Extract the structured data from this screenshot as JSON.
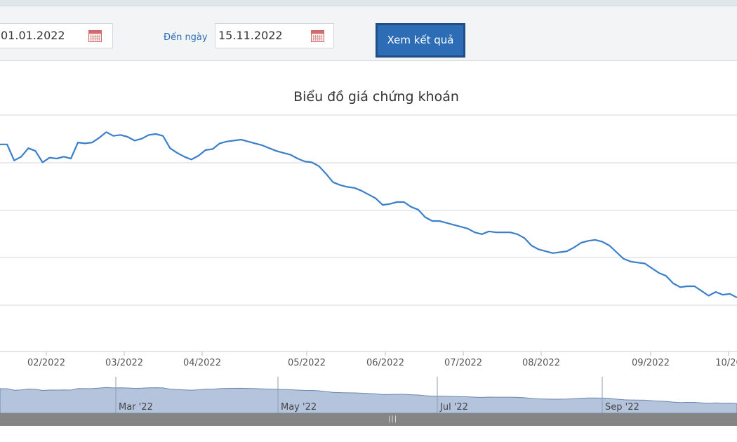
{
  "form": {
    "from_value": "01.01.2022",
    "to_label": "Đến ngày",
    "to_value": "15.11.2022",
    "submit_label": "Xem kết quả"
  },
  "chart_data": {
    "type": "line",
    "title": "Biểu đồ giá chứng khoán",
    "xlabel": "",
    "ylabel": "",
    "grid": true,
    "x_tick_labels": [
      "02/2022",
      "03/2022",
      "04/2022",
      "05/2022",
      "06/2022",
      "07/2022",
      "08/2022",
      "09/2022",
      "10/20"
    ],
    "series": [
      {
        "values": [
          41.9,
          41.9,
          40.2,
          40.6,
          41.5,
          41.2,
          40.0,
          40.5,
          40.4,
          40.6,
          40.4,
          42.1,
          42.0,
          42.1,
          42.6,
          43.2,
          42.8,
          42.9,
          42.7,
          42.3,
          42.5,
          42.9,
          43.0,
          42.8,
          41.5,
          41.0,
          40.6,
          40.3,
          40.7,
          41.3,
          41.4,
          42.0,
          42.2,
          42.3,
          42.4,
          42.2,
          42.0,
          41.8,
          41.5,
          41.2,
          41.0,
          40.8,
          40.4,
          40.1,
          40.0,
          39.6,
          38.8,
          37.9,
          37.6,
          37.4,
          37.3,
          37.0,
          36.6,
          36.2,
          35.5,
          35.6,
          35.8,
          35.8,
          35.3,
          35.0,
          34.2,
          33.8,
          33.8,
          33.6,
          33.4,
          33.2,
          33.0,
          32.6,
          32.4,
          32.7,
          32.6,
          32.6,
          32.6,
          32.4,
          32.0,
          31.2,
          30.8,
          30.6,
          30.4,
          30.5,
          30.6,
          31.0,
          31.5,
          31.7,
          31.8,
          31.6,
          31.2,
          30.5,
          29.8,
          29.5,
          29.4,
          29.3,
          28.8,
          28.3,
          28.0,
          27.2,
          26.8,
          26.9,
          26.9,
          26.4,
          25.9,
          26.3,
          26.0,
          26.1,
          25.7
        ],
        "sample_every_days": 3
      }
    ],
    "x_range": [
      "2022-01-03",
      "2022-10-15"
    ],
    "navigator": {
      "labels": [
        "Mar '22",
        "May '22",
        "Jul '22",
        "Sep '22"
      ]
    }
  }
}
